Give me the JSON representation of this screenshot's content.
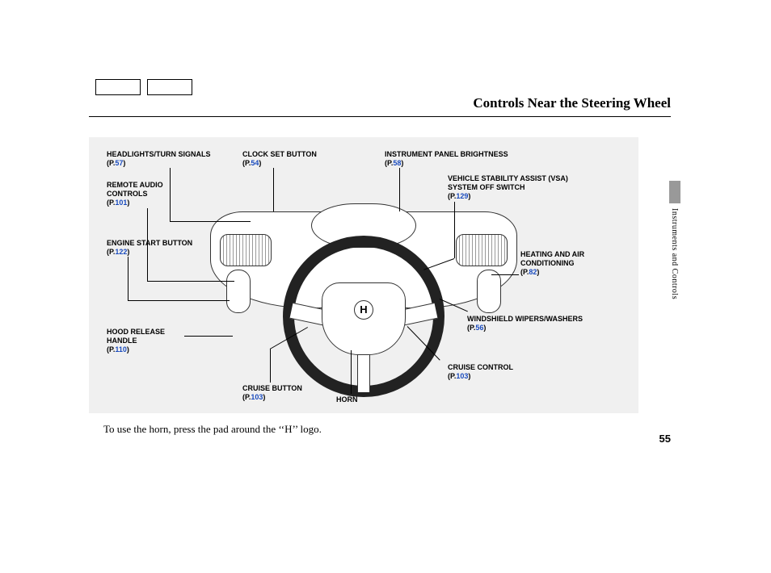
{
  "page": {
    "title": "Controls Near the Steering Wheel",
    "section": "Instruments and Controls",
    "number": "55",
    "caption": "To use the horn, press the pad around the ‘‘H’’ logo."
  },
  "labels": {
    "headlights": {
      "title": "HEADLIGHTS/TURN SIGNALS",
      "prefix": "(P.",
      "page": "57",
      "suffix": ")"
    },
    "remote_audio": {
      "title": "REMOTE AUDIO CONTROLS",
      "prefix": "(P.",
      "page": "101",
      "suffix": ")"
    },
    "engine_start": {
      "title": "ENGINE START BUTTON",
      "prefix": "(P.",
      "page": "122",
      "suffix": ")"
    },
    "hood_release": {
      "title": "HOOD RELEASE HANDLE",
      "prefix": "(P.",
      "page": "110",
      "suffix": ")"
    },
    "clock_set": {
      "title": "CLOCK SET BUTTON",
      "prefix": "(P.",
      "page": "54",
      "suffix": ")"
    },
    "panel_brightness": {
      "title": "INSTRUMENT PANEL BRIGHTNESS",
      "prefix": "(P.",
      "page": "58",
      "suffix": ")"
    },
    "vsa": {
      "title": "VEHICLE STABILITY ASSIST (VSA) SYSTEM OFF SWITCH",
      "prefix": "(P.",
      "page": "129",
      "suffix": ")"
    },
    "hvac": {
      "title": "HEATING AND AIR CONDITIONING",
      "prefix": "(P.",
      "page": "82",
      "suffix": ")"
    },
    "wipers": {
      "title": "WINDSHIELD WIPERS/WASHERS",
      "prefix": "(P.",
      "page": "56",
      "suffix": ")"
    },
    "cruise_control": {
      "title": "CRUISE CONTROL",
      "prefix": "(P.",
      "page": "103",
      "suffix": ")"
    },
    "cruise_button": {
      "title": "CRUISE BUTTON",
      "prefix": "(P.",
      "page": "103",
      "suffix": ")"
    },
    "horn": {
      "title": "HORN"
    }
  },
  "logo": "H"
}
